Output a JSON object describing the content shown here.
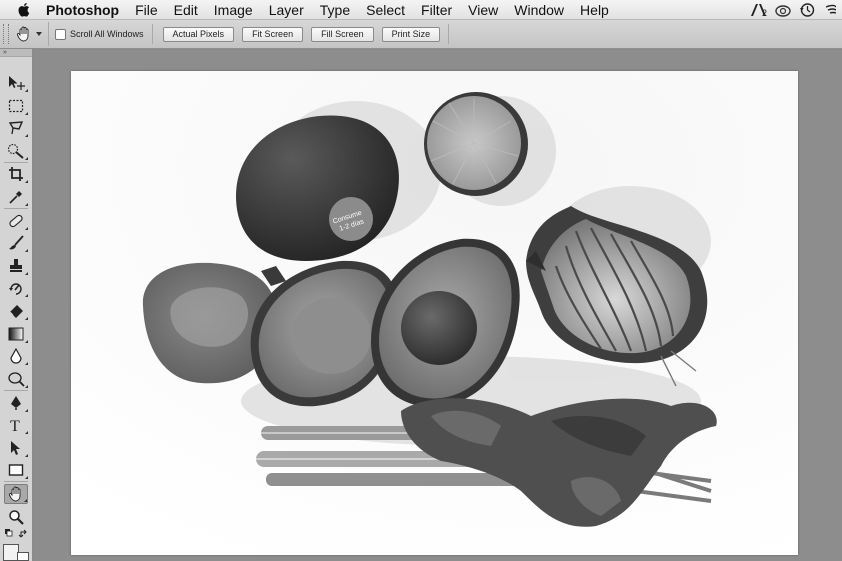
{
  "menubar": {
    "app_name": "Photoshop",
    "items": [
      "File",
      "Edit",
      "Image",
      "Layer",
      "Type",
      "Select",
      "Filter",
      "View",
      "Window",
      "Help"
    ],
    "right_icons": [
      "adobe-creative-cloud-icon",
      "creative-cloud-sync-icon",
      "time-machine-icon",
      "wifi-icon"
    ]
  },
  "options_bar": {
    "scroll_all_windows_label": "Scroll All Windows",
    "scroll_all_windows_checked": false,
    "actual_pixels_label": "Actual Pixels",
    "fit_screen_label": "Fit Screen",
    "fill_screen_label": "Fill Screen",
    "print_size_label": "Print Size"
  },
  "toolbox": {
    "header": "»",
    "active_tool": "hand-tool",
    "tools": [
      "move-tool",
      "rectangular-marquee-tool",
      "lasso-tool",
      "quick-selection-tool",
      "crop-tool",
      "eyedropper-tool",
      "spot-healing-tool",
      "brush-tool",
      "clone-stamp-tool",
      "history-brush-tool",
      "eraser-tool",
      "gradient-tool",
      "blur-tool",
      "dodge-tool",
      "pen-tool",
      "type-tool",
      "path-selection-tool",
      "rectangle-tool",
      "hand-tool",
      "zoom-tool"
    ]
  },
  "document": {
    "sticker_text_line1": "Consume",
    "sticker_text_line2": "1-2 días"
  }
}
